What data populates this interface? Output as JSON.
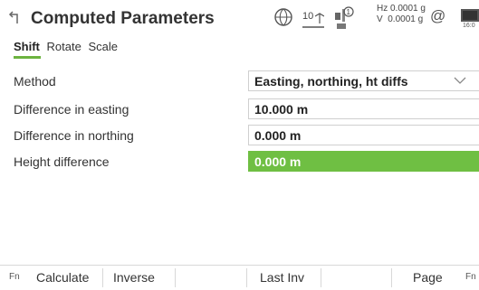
{
  "header": {
    "title": "Computed Parameters",
    "status": {
      "satellite_count": "10",
      "hz": "Hz 0.0001 g",
      "v": "V  0.0001 g",
      "at_symbol": "@",
      "battery_time": "16:0"
    }
  },
  "tabs": [
    {
      "label": "Shift",
      "active": true
    },
    {
      "label": "Rotate",
      "active": false
    },
    {
      "label": "Scale",
      "active": false
    }
  ],
  "fields": {
    "method": {
      "label": "Method",
      "value": "Easting, northing, ht diffs"
    },
    "diff_easting": {
      "label": "Difference in easting",
      "value": "10.000 m"
    },
    "diff_northing": {
      "label": "Difference in northing",
      "value": "0.000 m"
    },
    "height_diff": {
      "label": "Height difference",
      "value": "0.000 m"
    }
  },
  "softkeys": {
    "fn_left": "Fn",
    "calculate": "Calculate",
    "inverse": "Inverse",
    "last_inv": "Last Inv",
    "page": "Page",
    "fn_right": "Fn"
  },
  "colors": {
    "accent": "#6fbf43"
  },
  "icons": [
    "back-arrow-icon",
    "globe-icon",
    "antenna-icon",
    "satellite-icon",
    "battery-icon",
    "chevron-down-icon"
  ]
}
